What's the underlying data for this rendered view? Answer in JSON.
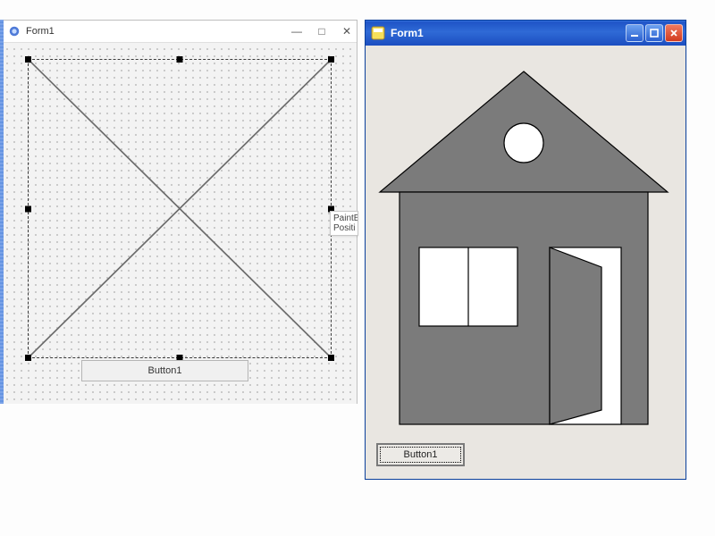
{
  "designer": {
    "title": "Form1",
    "minimize": "—",
    "maximize": "□",
    "close": "✕",
    "hint_line1": "PaintB",
    "hint_line2": "Positi",
    "button_label": "Button1"
  },
  "runtime": {
    "title": "Form1",
    "button_label": "Button1",
    "house": {
      "wall_fill": "#7b7b7b",
      "roof_fill": "#7b7b7b",
      "stroke": "#000000",
      "circle_fill": "#ffffff",
      "window_fill": "#ffffff",
      "door_fill": "#7b7b7b"
    }
  }
}
